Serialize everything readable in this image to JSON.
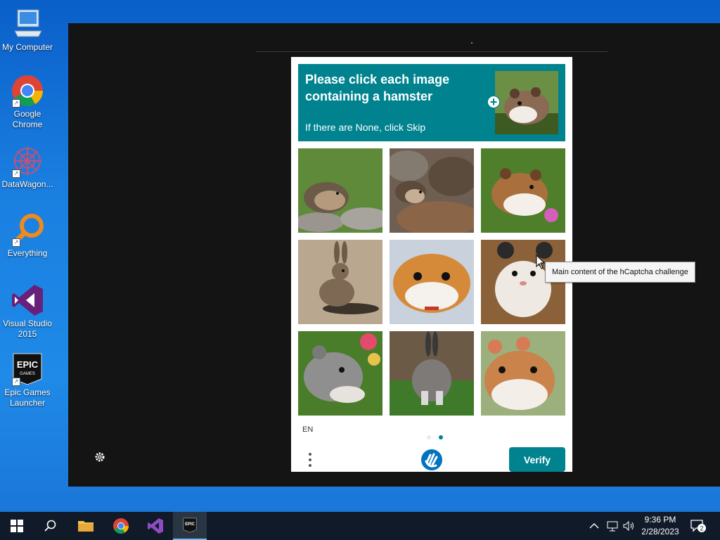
{
  "desktop": {
    "icons": [
      {
        "label": "My Computer",
        "icon": "computer-icon"
      },
      {
        "label": "Google Chrome",
        "icon": "chrome-icon"
      },
      {
        "label": "DataWagon...",
        "icon": "datawagon-icon"
      },
      {
        "label": "Everything",
        "icon": "everything-search-icon"
      },
      {
        "label": "Visual Studio 2015",
        "icon": "visual-studio-icon"
      },
      {
        "label": "Epic Games Launcher",
        "icon": "epic-games-icon"
      }
    ]
  },
  "captcha": {
    "prompt_title": "Please click each image containing a hamster",
    "prompt_sub": "If there are None, click Skip",
    "sample_image": "hamster",
    "tiles": [
      {
        "subject": "hedgehog"
      },
      {
        "subject": "hedgehog"
      },
      {
        "subject": "hamster"
      },
      {
        "subject": "rabbit"
      },
      {
        "subject": "hamster"
      },
      {
        "subject": "hamster"
      },
      {
        "subject": "mouse"
      },
      {
        "subject": "rabbit"
      },
      {
        "subject": "hamster"
      }
    ],
    "language": "EN",
    "page_count": 2,
    "current_page": 2,
    "verify_label": "Verify",
    "accent_color": "#00838f"
  },
  "tooltip": {
    "text": "Main content of the hCaptcha challenge"
  },
  "taskbar": {
    "apps": [
      "start-icon",
      "search-icon",
      "file-explorer-icon",
      "chrome-icon",
      "visual-studio-icon",
      "epic-games-icon"
    ],
    "active_app": "epic-games-icon",
    "time": "9:36 PM",
    "date": "2/28/2023",
    "notification_count": "2"
  }
}
